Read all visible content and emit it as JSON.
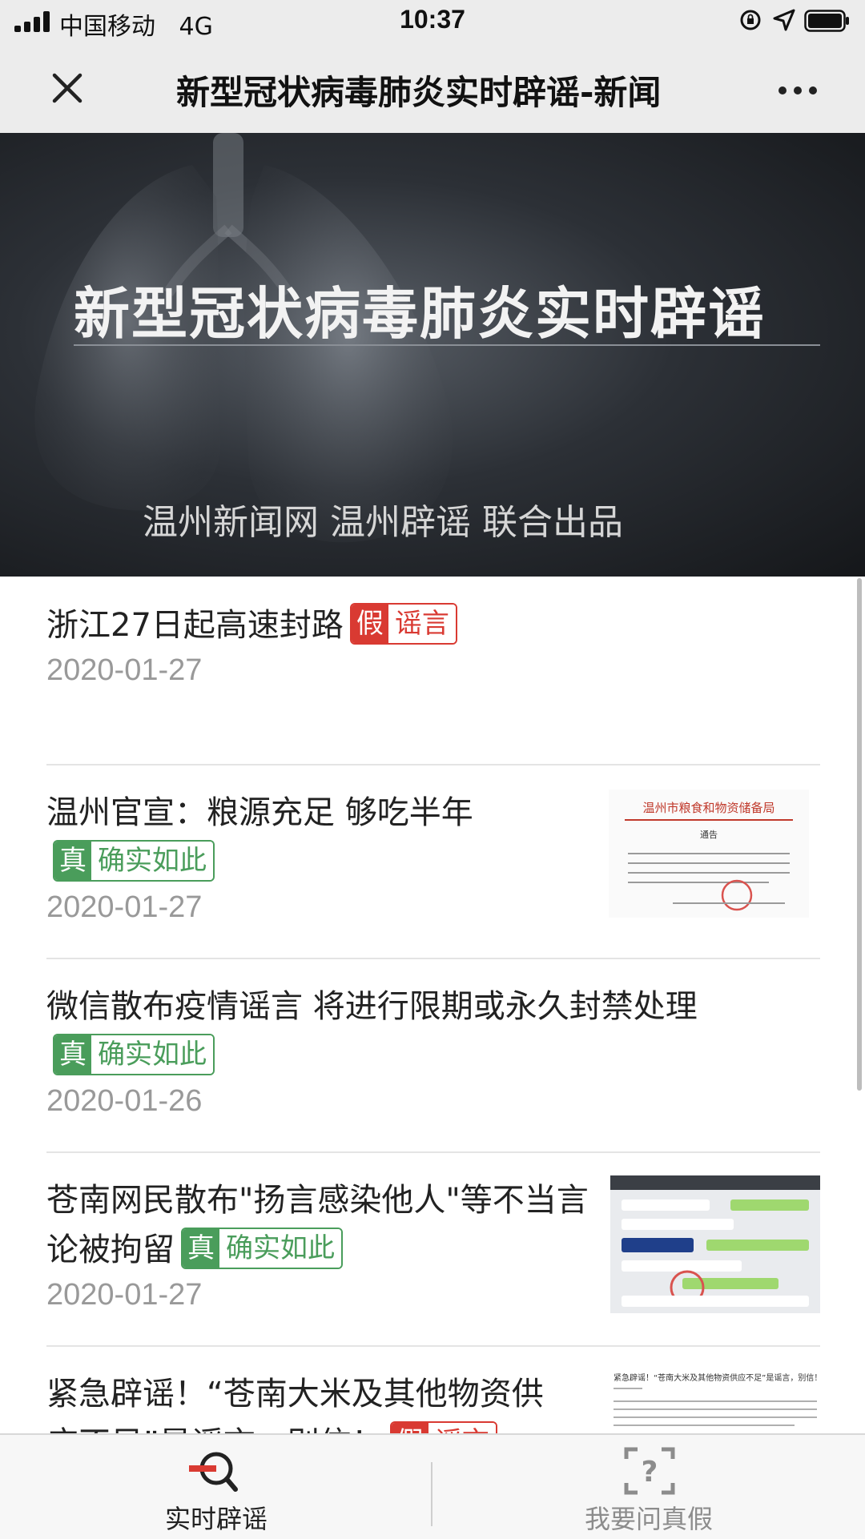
{
  "status_bar": {
    "carrier": "中国移动",
    "network": "4G",
    "time": "10:37"
  },
  "nav": {
    "title": "新型冠状病毒肺炎实时辟谣-新闻"
  },
  "banner": {
    "title": "新型冠状病毒肺炎实时辟谣",
    "credit": "温州新闻网  温州辟谣  联合出品"
  },
  "thumbnails": {
    "notice_header": "温州市粮食和物资储备局",
    "notice_subtitle": "通告",
    "article_header": "紧急辟谣！“苍南大米及其他物资供应不足”是谣言，别信！"
  },
  "items": [
    {
      "title": "浙江27日起高速封路",
      "verdict_key": "假",
      "verdict_text": "谣言",
      "date": "2020-01-27"
    },
    {
      "title": "温州官宣：粮源充足 够吃半年",
      "verdict_key": "真",
      "verdict_text": "确实如此",
      "date": "2020-01-27"
    },
    {
      "title": "微信散布疫情谣言 将进行限期或永久封禁处理",
      "verdict_key": "真",
      "verdict_text": "确实如此",
      "date": "2020-01-26"
    },
    {
      "title": "苍南网民散布\"扬言感染他人\"等不当言论被拘留",
      "verdict_key": "真",
      "verdict_text": "确实如此",
      "date": "2020-01-27"
    },
    {
      "title": "紧急辟谣！“苍南大米及其他物资供应不足”是谣言，别信！",
      "verdict_key": "假",
      "verdict_text": "谣言",
      "date": ""
    }
  ],
  "tabs": [
    {
      "label": "实时辟谣",
      "icon": "search-rumor-icon",
      "active": true
    },
    {
      "label": "我要问真假",
      "icon": "question-icon",
      "active": false
    }
  ],
  "colors": {
    "false_badge": "#d93a32",
    "true_badge": "#4a9d5b",
    "active_tab": "#d93a32"
  }
}
